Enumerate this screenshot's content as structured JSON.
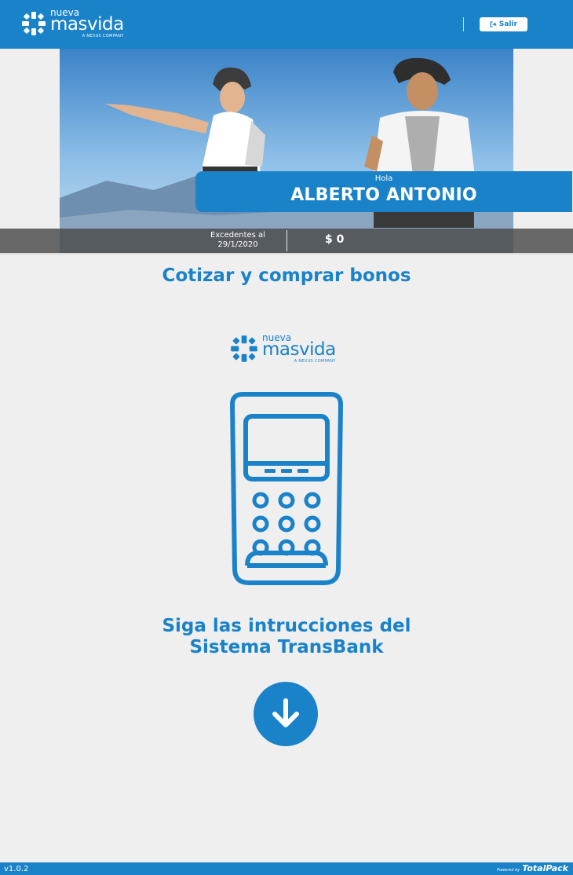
{
  "header": {
    "logo": {
      "line1": "nueva",
      "line2": "masvida",
      "line3": "A NEXUS COMPANY"
    },
    "exit_label": "Salir",
    "exit_icon": "sign-out-icon"
  },
  "hero": {
    "greeting": "Hola",
    "user_name": "ALBERTO ANTONIO",
    "balance_label_1": "Excedentes al",
    "balance_label_2": "29/1/2020",
    "balance_amount": "$ 0"
  },
  "main": {
    "title": "Cotizar y comprar bonos",
    "logo": {
      "line1": "nueva",
      "line2": "masvida",
      "line3": "A NEXUS COMPANY"
    },
    "terminal_icon": "payment-terminal-icon",
    "instruction_line1": "Siga las intrucciones del",
    "instruction_line2": "Sistema TransBank",
    "arrow_icon": "arrow-down-icon"
  },
  "footer": {
    "version": "v1.0.2",
    "powered_by": "Powered by",
    "brand": "TotalPack"
  },
  "colors": {
    "primary": "#1a82c8",
    "background": "#efefef",
    "balance_bar": "#4b4b4b"
  }
}
